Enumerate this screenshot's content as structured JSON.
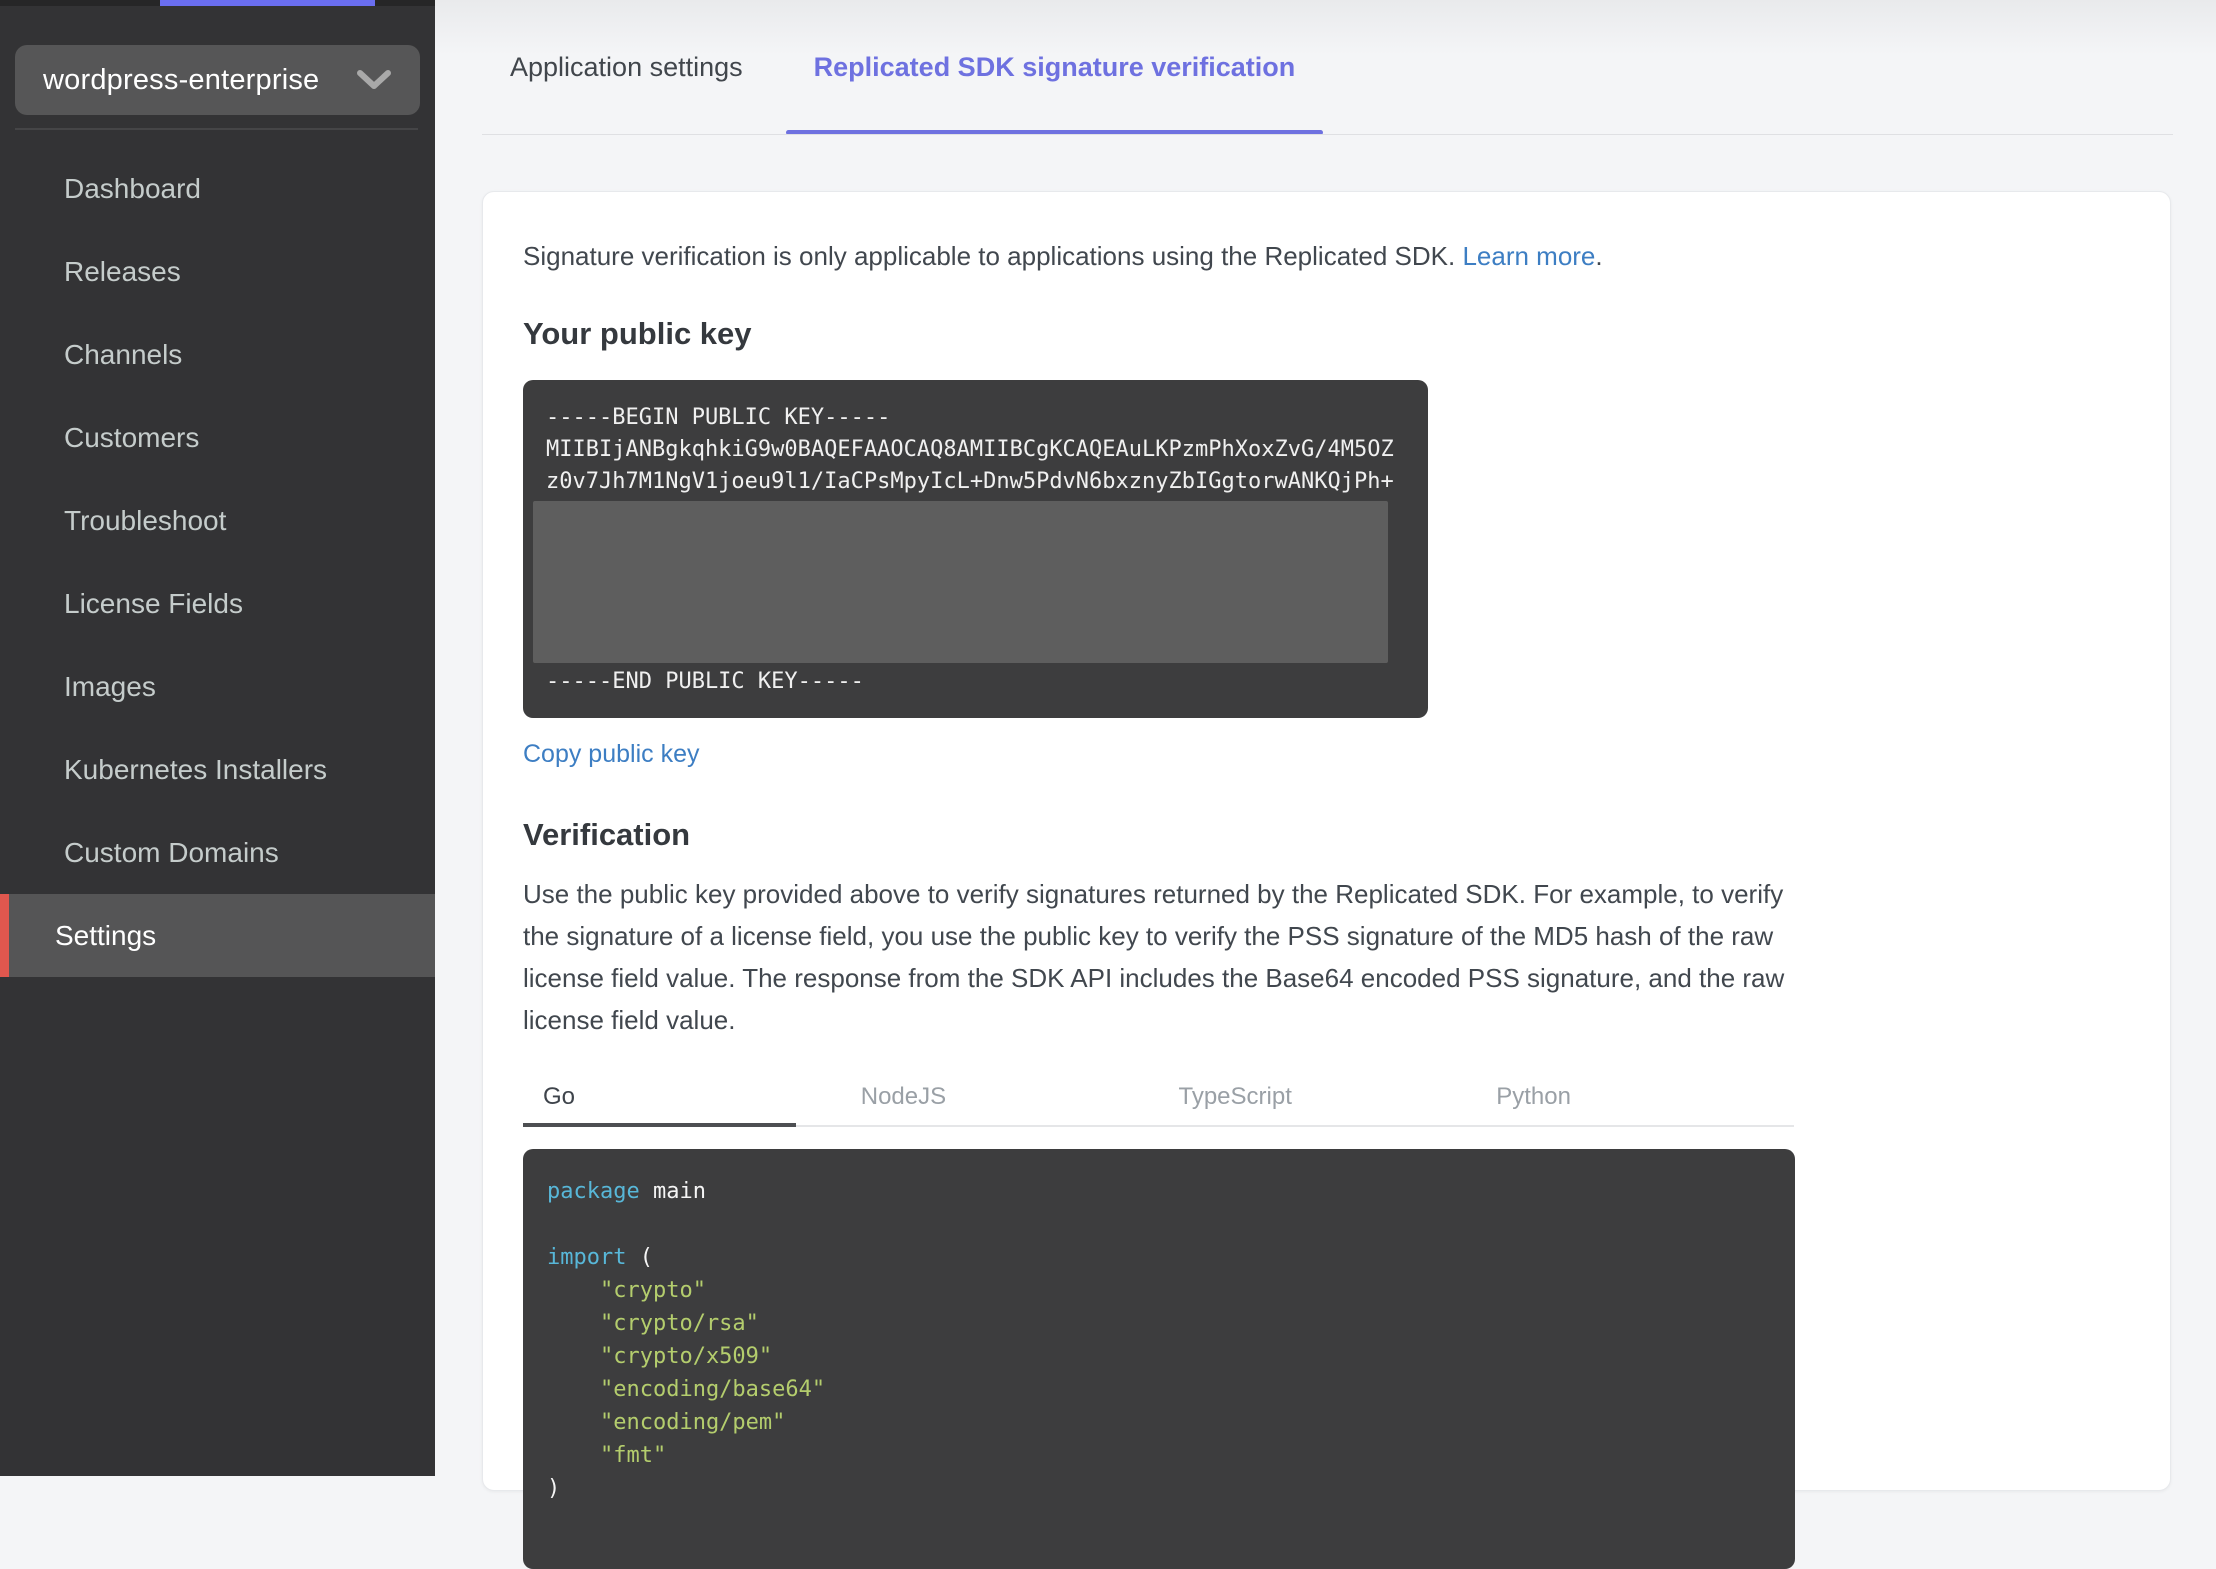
{
  "app_selector": {
    "value": "wordpress-enterprise"
  },
  "sidebar": {
    "items": [
      {
        "label": "Dashboard",
        "active": false
      },
      {
        "label": "Releases",
        "active": false
      },
      {
        "label": "Channels",
        "active": false
      },
      {
        "label": "Customers",
        "active": false
      },
      {
        "label": "Troubleshoot",
        "active": false
      },
      {
        "label": "License Fields",
        "active": false
      },
      {
        "label": "Images",
        "active": false
      },
      {
        "label": "Kubernetes Installers",
        "active": false
      },
      {
        "label": "Custom Domains",
        "active": false
      },
      {
        "label": "Settings",
        "active": true
      }
    ]
  },
  "tabs": [
    {
      "label": "Application settings",
      "active": false
    },
    {
      "label": "Replicated SDK signature verification",
      "active": true
    }
  ],
  "intro": {
    "text": "Signature verification is only applicable to applications using the Replicated SDK. ",
    "link_label": "Learn more",
    "suffix": "."
  },
  "public_key": {
    "heading": "Your public key",
    "line1": "-----BEGIN PUBLIC KEY-----",
    "line2": "MIIBIjANBgkqhkiG9w0BAQEFAAOCAQ8AMIIBCgKCAQEAuLKPzmPhXoxZvG/4M5OZ",
    "line3": "z0v7Jh7M1NgV1joeu9l1/IaCPsMpyIcL+Dnw5PdvN6bxznyZbIGgtorwANKQjPh+",
    "end_line": "-----END PUBLIC KEY-----",
    "copy_label": "Copy public key"
  },
  "verification": {
    "heading": "Verification",
    "body": "Use the public key provided above to verify signatures returned by the Replicated SDK. For example, to verify the signature of a license field, you use the public key to verify the PSS signature of the MD5 hash of the raw license field value. The response from the SDK API includes the Base64 encoded PSS signature, and the raw license field value."
  },
  "code_tabs": [
    {
      "label": "Go",
      "active": true
    },
    {
      "label": "NodeJS",
      "active": false
    },
    {
      "label": "TypeScript",
      "active": false
    },
    {
      "label": "Python",
      "active": false
    }
  ],
  "code": {
    "lines": [
      {
        "segments": [
          {
            "t": "package",
            "c": "kw"
          },
          {
            "t": " main",
            "c": "pl"
          }
        ]
      },
      {
        "segments": []
      },
      {
        "segments": [
          {
            "t": "import",
            "c": "kw"
          },
          {
            "t": " (",
            "c": "pl"
          }
        ]
      },
      {
        "segments": [
          {
            "t": "    \"crypto\"",
            "c": "str"
          }
        ]
      },
      {
        "segments": [
          {
            "t": "    \"crypto/rsa\"",
            "c": "str"
          }
        ]
      },
      {
        "segments": [
          {
            "t": "    \"crypto/x509\"",
            "c": "str"
          }
        ]
      },
      {
        "segments": [
          {
            "t": "    \"encoding/base64\"",
            "c": "str"
          }
        ]
      },
      {
        "segments": [
          {
            "t": "    \"encoding/pem\"",
            "c": "str"
          }
        ]
      },
      {
        "segments": [
          {
            "t": "    \"fmt\"",
            "c": "str"
          }
        ]
      },
      {
        "segments": [
          {
            "t": ")",
            "c": "pl"
          }
        ]
      }
    ]
  },
  "colors": {
    "accent_purple": "#6e71e0",
    "top_accent": "#6a6ef0",
    "link_blue": "#3d7ec3",
    "sidebar_bg": "#333335",
    "sidebar_active_bg": "#555556",
    "sidebar_active_accent": "#e0574e",
    "code_bg": "#3d3d3e",
    "code_keyword": "#58b7d8",
    "code_string": "#b4cd6d",
    "redacted_overlay": "#5e5e5e",
    "card_bg": "#ffffff",
    "page_bg": "#f4f5f7"
  },
  "icons": {
    "chevron_down": "chevron-down-icon"
  }
}
